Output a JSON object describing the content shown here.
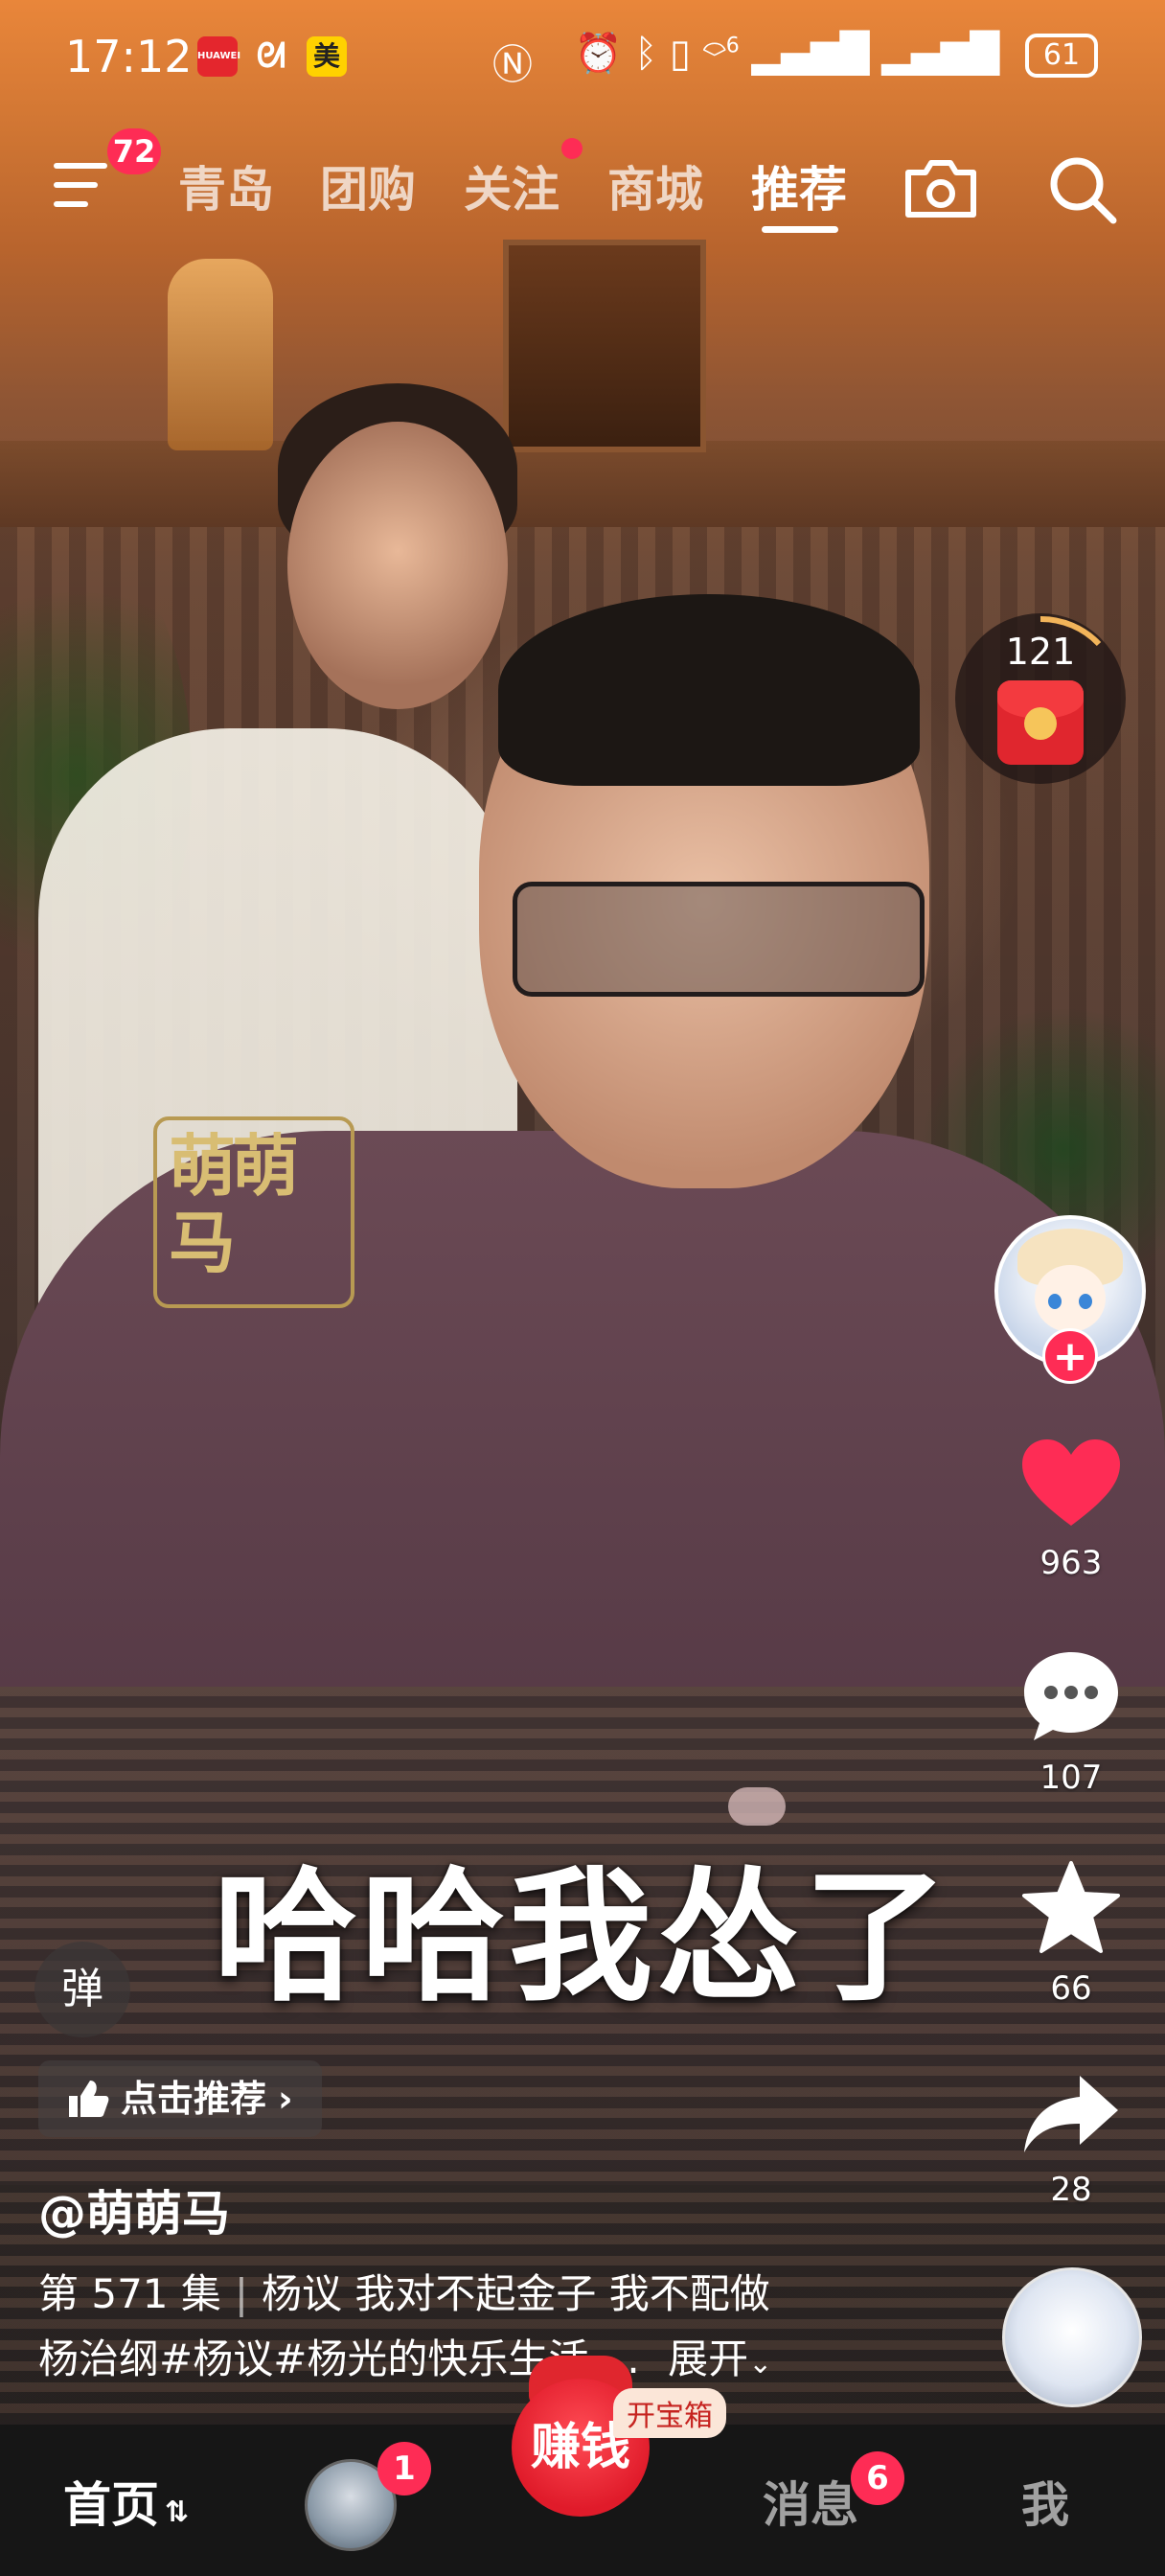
{
  "status_bar": {
    "time": "17:12",
    "app_icons": [
      "HUAWEI",
      "ᘛ",
      "美"
    ],
    "network": "6",
    "battery": "61"
  },
  "top_nav": {
    "menu_badge": "72",
    "tabs": [
      {
        "label": "青岛"
      },
      {
        "label": "团购"
      },
      {
        "label": "关注"
      },
      {
        "label": "商城"
      },
      {
        "label": "推荐"
      }
    ],
    "active_tab": "推荐"
  },
  "red_packet": {
    "count": "121"
  },
  "video": {
    "watermark": "萌萌马",
    "subtitle": "哈哈我怂了"
  },
  "actions": {
    "likes": "963",
    "comments": "107",
    "favorites": "66",
    "shares": "28"
  },
  "overlay": {
    "danmu_label": "弹",
    "recommend_label": "点击推荐",
    "author": "@萌萌马",
    "episode": "第 571 集",
    "title": "杨议 我对不起金子 我不配做",
    "tags": "杨治纲#杨议#杨光的快乐生活 ...",
    "expand_label": "展开"
  },
  "bottom_tabs": {
    "home": "首页",
    "friend_badge": "1",
    "earn": "赚钱",
    "treasure": "开宝箱",
    "messages": "消息",
    "messages_badge": "6",
    "me": "我"
  },
  "colors": {
    "accent": "#fe2c55",
    "tabbar": "#161616"
  }
}
